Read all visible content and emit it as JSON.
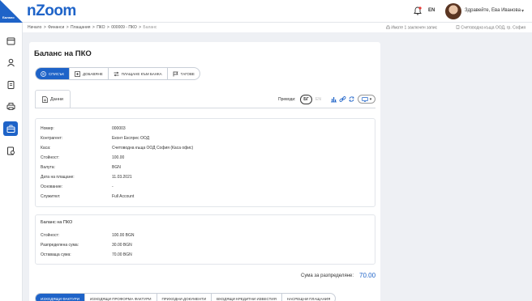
{
  "app": {
    "corner_text": "Балано",
    "logo": "nZoom",
    "lang": "EN",
    "user_name": "Здравейте, Ева Иванова"
  },
  "breadcrumb": {
    "items": [
      "Начало",
      "Финанси",
      "Плащания",
      "ПКО",
      "000009 - ПКО",
      "Баланс"
    ],
    "separator": ">",
    "right_info": "Имате 1 заключен запис",
    "right_company": "Счетоводна къща ООД, гр. София"
  },
  "sidebar": {
    "icons": [
      "calendar-icon",
      "user-icon",
      "clipboard-icon",
      "printer-icon",
      "cashbox-icon",
      "report-icon"
    ],
    "active_index": 4
  },
  "page": {
    "title": "Баланс на ПКО"
  },
  "actions": {
    "items": [
      {
        "label": "СПИСЪК",
        "icon": "list-icon"
      },
      {
        "label": "ДОБАВЯНЕ",
        "icon": "add-icon"
      },
      {
        "label": "ПЛАЩАНЕ КЪМ БАНКА",
        "icon": "bank-transfer-icon"
      },
      {
        "label": "ТАГОВЕ",
        "icon": "flag-icon"
      }
    ],
    "active_index": 0
  },
  "tabs": {
    "data_label": "Данни"
  },
  "translations": {
    "label": "Преводи:",
    "bg": "БГ",
    "en": "EN"
  },
  "details": {
    "rows": [
      {
        "label": "Номер:",
        "value": "000003"
      },
      {
        "label": "Контрагент:",
        "value": "Еконт Експрес ООД"
      },
      {
        "label": "Каса:",
        "value": "Счетоводна къща ООД София (Каса офис)"
      },
      {
        "label": "Стойност:",
        "value": "100.00"
      },
      {
        "label": "Валута:",
        "value": "BGN"
      },
      {
        "label": "Дата на плащане:",
        "value": "11.03.2021"
      },
      {
        "label": "Основание:",
        "value": "-"
      },
      {
        "label": "Служител:",
        "value": "Full Account"
      }
    ]
  },
  "balance": {
    "title": "Баланс на ПКО",
    "rows": [
      {
        "label": "Стойност:",
        "value": "100.00 BGN"
      },
      {
        "label": "Разпределена сума:",
        "value": "30.00 BGN"
      },
      {
        "label": "Оставаща сума:",
        "value": "70.00 BGN"
      }
    ]
  },
  "summary": {
    "label": "Сума за разпределяне:",
    "value": "70.00"
  },
  "bottom_tabs": {
    "items": [
      "ИЗХОДЯЩИ ФАКТУРИ",
      "ИЗХОДЯЩИ ПРОФОРМА ФАКТУРИ",
      "ПРИХОДНИ ДОКУМЕНТИ",
      "ВХОДЯЩИ КРЕДИТНИ ИЗВЕСТИЯ",
      "НАСРЕЩНИ ПЛАЩАНИЯ"
    ],
    "active_index": 0
  },
  "colors": {
    "accent": "#1e63c8",
    "bell_badge": "#e53935"
  }
}
